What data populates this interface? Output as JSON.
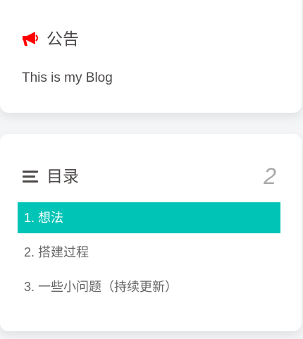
{
  "announcement": {
    "title": "公告",
    "icon": "bullhorn-icon",
    "icon_color": "#ff0000",
    "text": "This is my Blog"
  },
  "toc": {
    "title": "目录",
    "icon": "list-icon",
    "percent": "2",
    "active_color": "#00c4b6",
    "items": [
      {
        "label": "1. 想法",
        "active": true
      },
      {
        "label": "2. 搭建过程",
        "active": false
      },
      {
        "label": "3. 一些小问题（持续更新）",
        "active": false
      }
    ]
  }
}
